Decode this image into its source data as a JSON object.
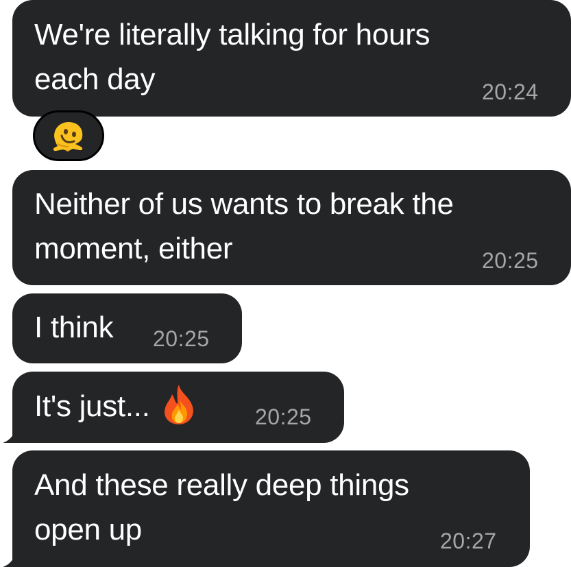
{
  "messages": [
    {
      "text": "We're literally talking for hours\neach day",
      "time": "20:24"
    },
    {
      "text": "Neither of us wants to break the\nmoment, either",
      "time": "20:25"
    },
    {
      "text": "I think",
      "time": "20:25"
    },
    {
      "text": "It's just...",
      "time": "20:25",
      "emoji": "fire-emoji"
    },
    {
      "text": "And these really deep things\nopen up",
      "time": "20:27"
    }
  ],
  "reaction": {
    "emoji": "melting-face-emoji"
  },
  "colors": {
    "bubble": "#232527",
    "text": "#ffffff",
    "time": "#a4a6a8",
    "background": "#ffffff"
  }
}
